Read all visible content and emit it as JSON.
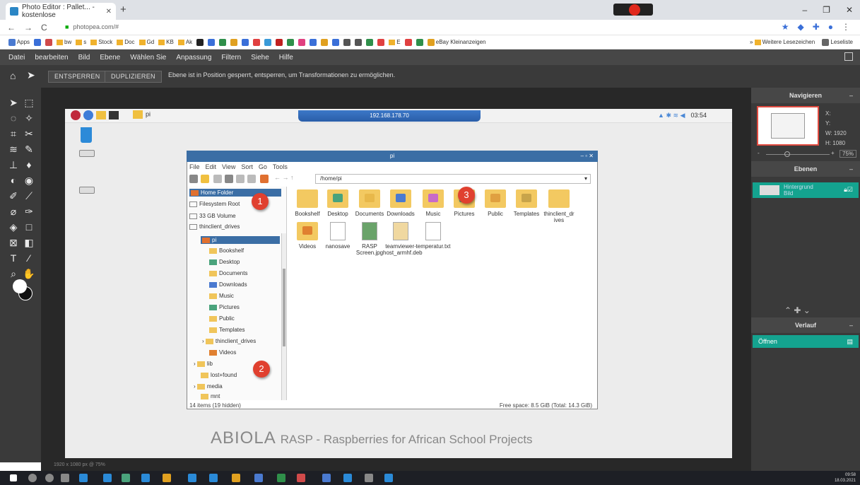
{
  "browser": {
    "tab_title": "Photo Editor : Pallet... - kostenlose",
    "tab_close": "✕",
    "new_tab": "+",
    "url": "photopea.com/#",
    "window_controls": [
      "–",
      "❐",
      "✕"
    ],
    "bookmarks": [
      "Apps",
      "bw",
      "s",
      "Stock",
      "Doc",
      "Gd",
      "KB",
      "Ak",
      "E",
      "eBay Kleinanzeigen"
    ],
    "bookmarks_more": "Weitere Lesezeichen",
    "reading_list": "Leseliste"
  },
  "editor": {
    "menu": [
      "Datei",
      "bearbeiten",
      "Bild",
      "Ebene",
      "Wählen Sie",
      "Anpassung",
      "Filtern",
      "Siehe",
      "Hilfe"
    ],
    "buttons": {
      "unlock": "ENTSPERREN",
      "duplicate": "DUPLIZIEREN"
    },
    "option_message": "Ebene ist in Position gesperrt, entsperren, um Transformationen zu ermöglichen.",
    "status": "1920 x 1080 px @ 75%",
    "panels": {
      "navigator": "Navigieren",
      "layers": "Ebenen",
      "history": "Verlauf",
      "open": "Öffnen"
    },
    "nav_info": {
      "x": "X:",
      "y": "Y:",
      "w": "W: 1920",
      "h": "H: 1080"
    },
    "zoom": "75%",
    "layer": {
      "name": "Hintergrund",
      "sub": "Bild"
    }
  },
  "pi_desktop": {
    "task_label": "pi",
    "clock": "03:54",
    "vnc_title": "192.168.178.70",
    "fm": {
      "title": "pi",
      "menu": [
        "File",
        "Edit",
        "View",
        "Sort",
        "Go",
        "Tools"
      ],
      "path": "/home/pi",
      "places": [
        "Home Folder",
        "Filesystem Root",
        "33 GB Volume",
        "thinclient_drives"
      ],
      "tree": [
        "pi",
        "Bookshelf",
        "Desktop",
        "Documents",
        "Downloads",
        "Music",
        "Pictures",
        "Public",
        "Templates",
        "thinclient_drives",
        "Videos",
        "lib",
        "lost+found",
        "media",
        "mnt"
      ],
      "files": [
        {
          "name": "Bookshelf",
          "color": "#f3c961"
        },
        {
          "name": "Desktop",
          "color": "#4aa37c"
        },
        {
          "name": "Documents",
          "color": "#e8b84a"
        },
        {
          "name": "Downloads",
          "color": "#4a7ad0"
        },
        {
          "name": "Music",
          "color": "#c86ac8"
        },
        {
          "name": "Pictures",
          "color": "#4aa37c"
        },
        {
          "name": "Public",
          "color": "#e0a040"
        },
        {
          "name": "Templates",
          "color": "#c8a44a"
        },
        {
          "name": "thinclient_dr ives",
          "color": "#f3c961"
        },
        {
          "name": "Videos",
          "color": "#e08030"
        }
      ],
      "docs": [
        "nanosave",
        "RASP Screen.jpg",
        "teamviewer-host_armhf.deb",
        "temperatur.txt"
      ],
      "status_left": "14 items (19 hidden)",
      "status_right": "Free space: 8.5 GiB (Total: 14.3 GiB)"
    },
    "callouts": [
      "1",
      "2",
      "3"
    ],
    "footer_brand": "ABIOLA",
    "footer_text": "RASP - Raspberries for African School Projects"
  },
  "taskbar": {
    "time": "09:58",
    "date": "18.03.2021"
  }
}
